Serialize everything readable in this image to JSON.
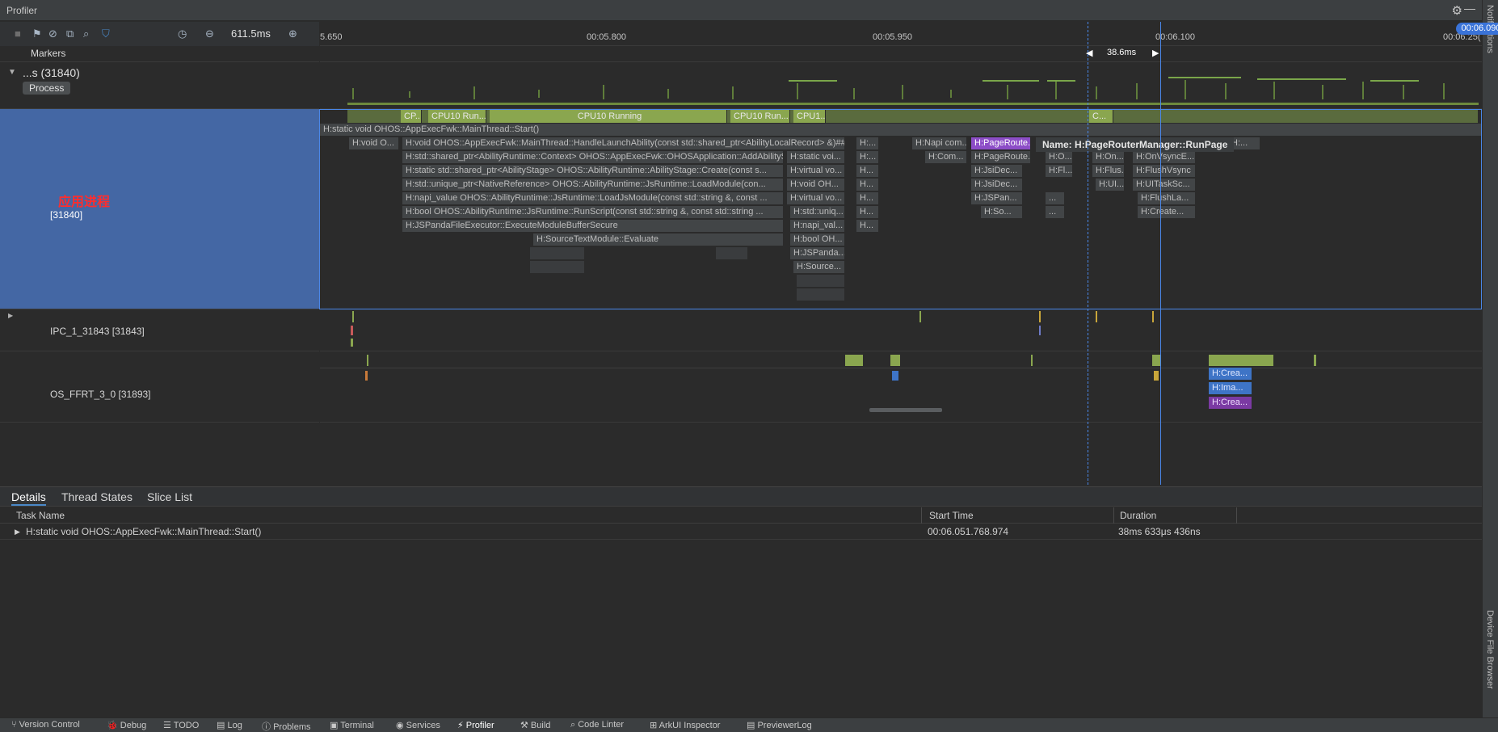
{
  "window": {
    "title": "Profiler"
  },
  "toolbar": {
    "zoom": "611.5ms"
  },
  "ruler": {
    "ticks": [
      "5.650",
      "00:05.800",
      "00:05.950",
      "00:06.100",
      "00:06.25("
    ],
    "cursor_time": "00:06.090",
    "measure": "38.6ms"
  },
  "tracks": {
    "markers_label": "Markers",
    "process_name": "...s (31840)",
    "process_badge": "Process",
    "main_thread_annotation": "应用进程",
    "main_thread_name": "[31840]",
    "thread2_name": "IPC_1_31843 [31843]",
    "thread3_name": "OS_FFRT_3_0 [31893]"
  },
  "cpu_row": [
    "CP...",
    "CPU10 Run...",
    "CPU10 Running",
    "CPU10 Run...",
    "CPU1...",
    "C..."
  ],
  "slices": {
    "root": "H:static void OHOS::AppExecFwk::MainThread::Start()",
    "r1a": "H:void O...",
    "r1b": "H:void OHOS::AppExecFwk::MainThread::HandleLaunchAbility(const std::shared_ptr<AbilityLocalRecord> &)##co...",
    "r1c": "H:...",
    "r1d": "H:Napi com...",
    "r1e": "H:PageRoute...",
    "r1f": "H:...",
    "r2a": "H:std::shared_ptr<AbilityRuntime::Context> OHOS::AppExecFwk::OHOSApplication::AddAbilitySta...",
    "r2b": "H:static voi...",
    "r2c": "H:...",
    "r2d": "H:Com...",
    "r2e": "H:PageRoute...",
    "r2f": "H:O...",
    "r2g": "H:On...",
    "r2h": "H:OnVsyncE...",
    "r3a": "H:static std::shared_ptr<AbilityStage> OHOS::AbilityRuntime::AbilityStage::Create(const s...",
    "r3b": "H:virtual vo...",
    "r3c": "H...",
    "r3d": "H:JsiDec...",
    "r3e": "H:Fl...",
    "r3f": "H:Flus...",
    "r3g": "H:FlushVsync",
    "r4a": "H:std::unique_ptr<NativeReference> OHOS::AbilityRuntime::JsRuntime::LoadModule(con...",
    "r4b": "H:void OH...",
    "r4c": "H...",
    "r4d": "H:JsiDec...",
    "r4e": "H:UI...",
    "r4f": "H:UITaskSc...",
    "r5a": "H:napi_value OHOS::AbilityRuntime::JsRuntime::LoadJsModule(const std::string &, const ...",
    "r5b": "H:virtual vo...",
    "r5c": "H...",
    "r5d": "H:JSPan...",
    "r5e": "...",
    "r5f": "H:FlushLa...",
    "r6a": "H:bool OHOS::AbilityRuntime::JsRuntime::RunScript(const std::string &, const std::string ...",
    "r6b": "H:std::uniq...",
    "r6c": "H...",
    "r6d": "H:So...",
    "r6e": "...",
    "r6f": "H:Create...",
    "r7a": "H:JSPandaFileExecutor::ExecuteModuleBufferSecure",
    "r7b": "H:napi_val...",
    "r7c": "H...",
    "r8a": "H:SourceTextModule::Evaluate",
    "r8b": "H:bool OH...",
    "r9": "H:JSPanda...",
    "r10": "H:Source...",
    "t3a": "H:Crea...",
    "t3b": "H:Ima...",
    "t3c": "H:Crea...",
    "far1": "H:...",
    "far2": "H:..."
  },
  "tooltip": {
    "label": "Name:",
    "value": "H:PageRouterManager::RunPage"
  },
  "bottom": {
    "tabs": [
      "Details",
      "Thread States",
      "Slice List"
    ],
    "columns": [
      "Task Name",
      "Start Time",
      "Duration"
    ],
    "rows": [
      {
        "name": "H:static void OHOS::AppExecFwk::MainThread::Start()",
        "start": "00:06.051.768.974",
        "duration": "38ms 633μs 436ns"
      }
    ]
  },
  "right_strip": {
    "notifications": "Notifications",
    "device_file_browser": "Device File Browser"
  },
  "statusbar": [
    "Version Control",
    "Debug",
    "TODO",
    "Log",
    "Problems",
    "Terminal",
    "Services",
    "Profiler",
    "Build",
    "Code Linter",
    "ArkUI Inspector",
    "PreviewerLog"
  ],
  "colors": {
    "selection": "#4467a4",
    "cpu": "#8aa64f",
    "highlight": "#8c4dc7",
    "accent": "#3a73d8"
  }
}
